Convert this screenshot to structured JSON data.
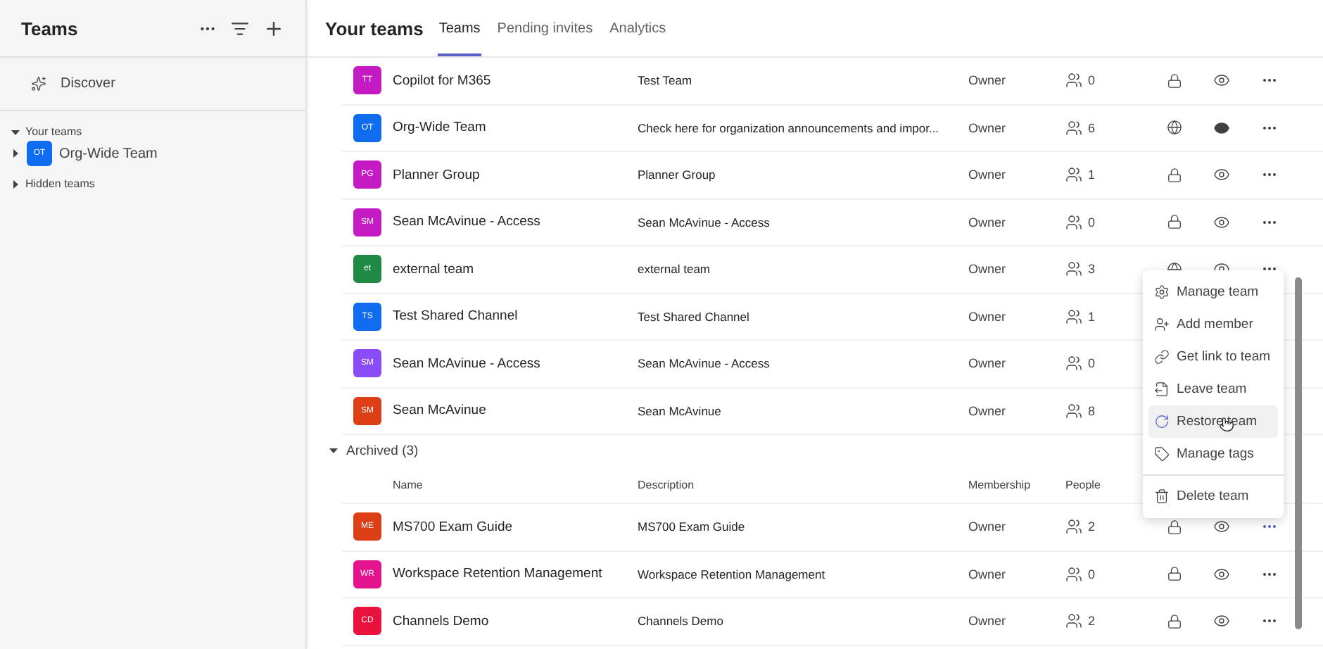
{
  "sidebar": {
    "title": "Teams",
    "discover": "Discover",
    "sections": [
      {
        "label": "Your teams",
        "expanded": true,
        "teams": [
          {
            "initials": "OT",
            "name": "Org-Wide Team",
            "color": "#0f6cef",
            "expanded": false
          }
        ]
      },
      {
        "label": "Hidden teams",
        "expanded": false
      }
    ]
  },
  "header": {
    "title": "Your teams",
    "tabs": [
      {
        "label": "Teams",
        "selected": true
      },
      {
        "label": "Pending invites",
        "selected": false
      },
      {
        "label": "Analytics",
        "selected": false
      }
    ]
  },
  "teams": [
    {
      "initials": "TT",
      "name": "Copilot for M365",
      "color": "#c41ac4",
      "description": "Test Team",
      "membership": "Owner",
      "people": "0",
      "public": false,
      "shown": false,
      "menu_open": false
    },
    {
      "initials": "OT",
      "name": "Org-Wide Team",
      "color": "#0f6cef",
      "description": "Check here for organization announcements and impor...",
      "membership": "Owner",
      "people": "6",
      "public": true,
      "shown": true,
      "menu_open": false
    },
    {
      "initials": "PG",
      "name": "Planner Group",
      "color": "#c41ac4",
      "description": "Planner Group",
      "membership": "Owner",
      "people": "1",
      "public": false,
      "shown": false,
      "menu_open": false
    },
    {
      "initials": "SM",
      "name": "Sean McAvinue - Access",
      "color": "#c41ac4",
      "description": "Sean McAvinue - Access",
      "membership": "Owner",
      "people": "0",
      "public": false,
      "shown": false,
      "menu_open": false
    },
    {
      "initials": "et",
      "name": "external team",
      "color": "#1e8a44",
      "description": "external team",
      "membership": "Owner",
      "people": "3",
      "public": true,
      "shown": false,
      "menu_open": false
    },
    {
      "initials": "TS",
      "name": "Test Shared Channel",
      "color": "#0f6cef",
      "description": "Test Shared Channel",
      "membership": "Owner",
      "people": "1"
    },
    {
      "initials": "SM",
      "name": "Sean McAvinue - Access",
      "color": "#8a4cf7",
      "description": "Sean McAvinue - Access",
      "membership": "Owner",
      "people": "0"
    },
    {
      "initials": "SM",
      "name": "Sean McAvinue",
      "color": "#dc3e15",
      "description": "Sean McAvinue",
      "membership": "Owner",
      "people": "8"
    }
  ],
  "archived": {
    "label": "Archived (3)",
    "expanded": true,
    "columns": [
      "Name",
      "Description",
      "Membership",
      "People"
    ],
    "teams": [
      {
        "initials": "ME",
        "name": "MS700 Exam Guide",
        "color": "#dc3e15",
        "description": "MS700 Exam Guide",
        "membership": "Owner",
        "people": "2",
        "public": false,
        "shown": false,
        "menu_open": true
      },
      {
        "initials": "WR",
        "name": "Workspace Retention Management",
        "color": "#e3138d",
        "description": "Workspace Retention Management",
        "membership": "Owner",
        "people": "0",
        "public": false,
        "shown": false,
        "menu_open": false
      },
      {
        "initials": "CD",
        "name": "Channels Demo",
        "color": "#e8123c",
        "description": "Channels Demo",
        "membership": "Owner",
        "people": "2",
        "public": false,
        "shown": false,
        "menu_open": false
      }
    ]
  },
  "menu": [
    {
      "kind": "settings",
      "label": "Manage team",
      "highlighted": false
    },
    {
      "kind": "add-member",
      "label": "Add member",
      "highlighted": false
    },
    {
      "kind": "link",
      "label": "Get link to team",
      "highlighted": false
    },
    {
      "kind": "leave",
      "label": "Leave team",
      "highlighted": false
    },
    {
      "kind": "restore",
      "label": "Restore team",
      "highlighted": true
    },
    {
      "kind": "tag",
      "label": "Manage tags",
      "highlighted": false
    },
    {
      "kind": "delete",
      "label": "Delete team",
      "highlighted": false
    }
  ]
}
